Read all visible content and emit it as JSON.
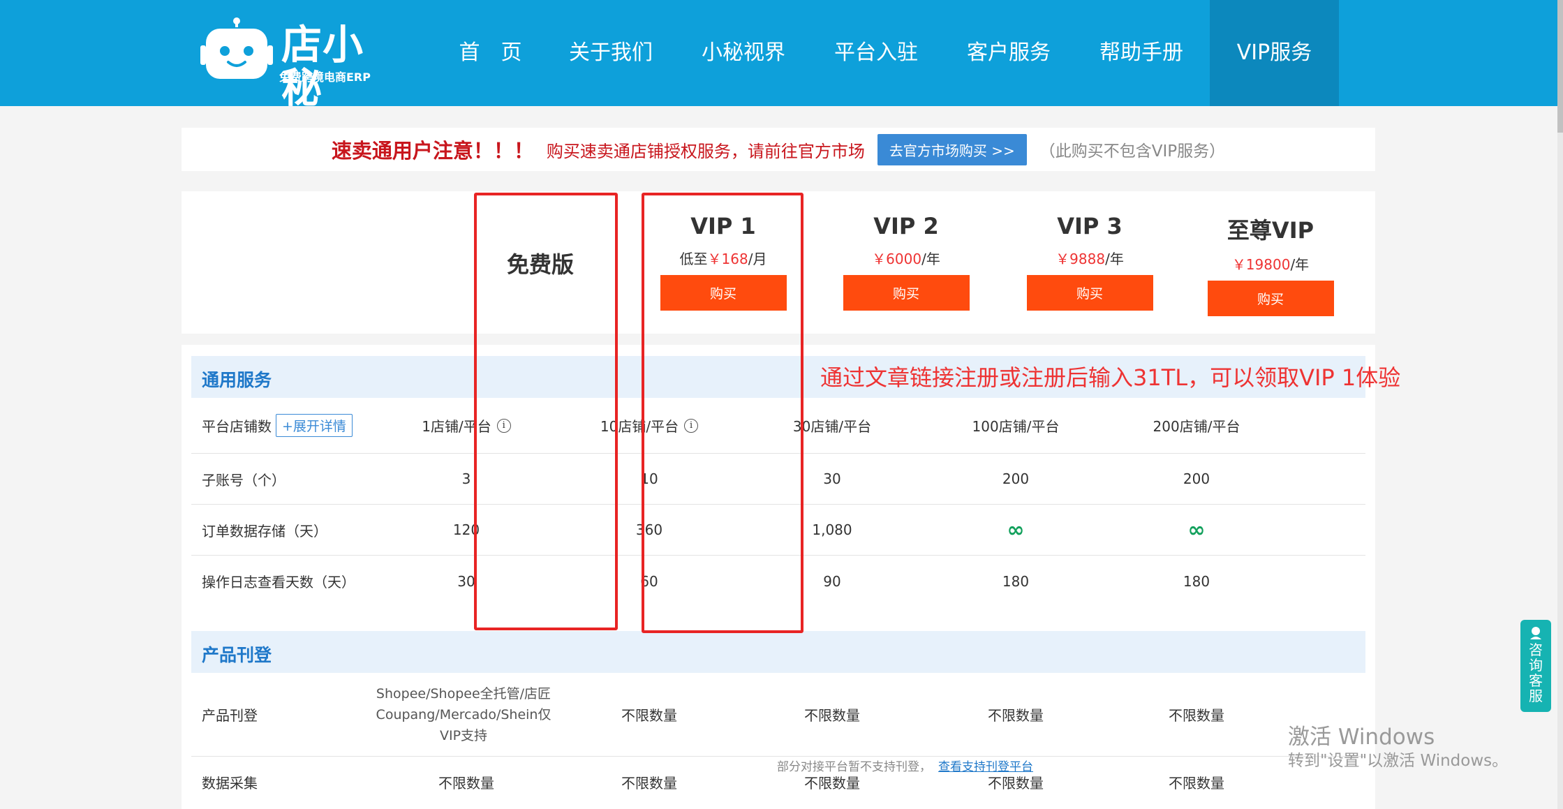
{
  "brand": {
    "name": "店小秘",
    "tagline": "免费跨境电商ERP"
  },
  "nav": [
    {
      "label": "首　页",
      "active": false
    },
    {
      "label": "关于我们",
      "active": false
    },
    {
      "label": "小秘视界",
      "active": false
    },
    {
      "label": "平台入驻",
      "active": false
    },
    {
      "label": "客户服务",
      "active": false
    },
    {
      "label": "帮助手册",
      "active": false
    },
    {
      "label": "VIP服务",
      "active": true
    }
  ],
  "notice": {
    "title": "速卖通用户注意！！！",
    "desc": "购买速卖通店铺授权服务，请前往官方市场",
    "button": "去官方市场购买 >>",
    "note": "（此购买不包含VIP服务）"
  },
  "plans": [
    {
      "name": "免费版",
      "price_prefix": "",
      "price": "",
      "unit": "",
      "buy": ""
    },
    {
      "name": "VIP 1",
      "price_prefix": "低至",
      "price": "￥168",
      "unit": "/月",
      "buy": "购买"
    },
    {
      "name": "VIP 2",
      "price_prefix": "",
      "price": "￥6000",
      "unit": "/年",
      "buy": "购买"
    },
    {
      "name": "VIP 3",
      "price_prefix": "",
      "price": "￥9888",
      "unit": "/年",
      "buy": "购买"
    },
    {
      "name": "至尊VIP",
      "price_prefix": "",
      "price": "￥19800",
      "unit": "/年",
      "buy": "购买"
    }
  ],
  "promo": "通过文章链接注册或注册后输入31TL，可以领取VIP 1体验",
  "sections": [
    {
      "title": "通用服务",
      "rows": [
        {
          "label": "平台店铺数",
          "action": "+展开详情",
          "values": [
            "1店铺/平台",
            "10店铺/平台",
            "30店铺/平台",
            "100店铺/平台",
            "200店铺/平台"
          ]
        },
        {
          "label": "子账号（个）",
          "values": [
            "3",
            "10",
            "30",
            "200",
            "200"
          ]
        },
        {
          "label": "订单数据存储（天）",
          "values": [
            "120",
            "360",
            "1,080",
            "∞",
            "∞"
          ]
        },
        {
          "label": "操作日志查看天数（天）",
          "values": [
            "30",
            "60",
            "90",
            "180",
            "180"
          ]
        }
      ]
    },
    {
      "title": "产品刊登",
      "rows": [
        {
          "label": "产品刊登",
          "values": [
            "Shopee/Shopee全托管/店匠 Coupang/Mercado/Shein仅VIP支持",
            "不限数量",
            "不限数量",
            "不限数量",
            "不限数量"
          ],
          "note": "部分对接平台暂不支持刊登，",
          "note_link": "查看支持刊登平台"
        },
        {
          "label": "数据采集",
          "values": [
            "不限数量",
            "不限数量",
            "不限数量",
            "不限数量",
            "不限数量"
          ]
        }
      ]
    }
  ],
  "chat": {
    "label": "咨询客服"
  },
  "watermark": {
    "line1": "激活 Windows",
    "line2": "转到\"设置\"以激活 Windows。"
  }
}
